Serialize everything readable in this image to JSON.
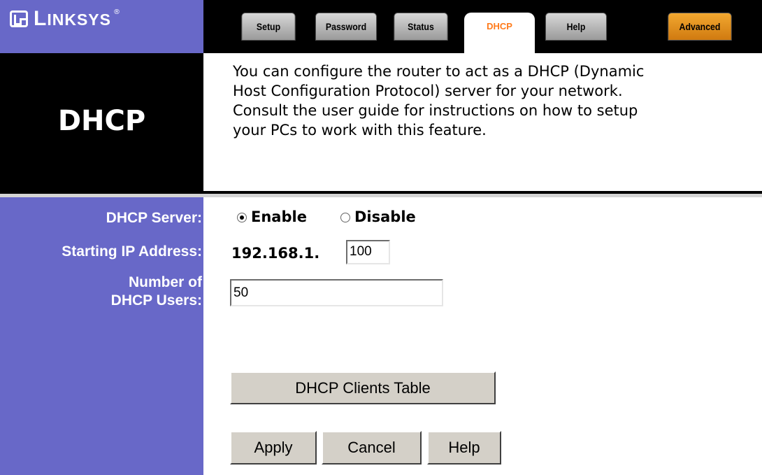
{
  "brand": {
    "name_big": "L",
    "name_rest": "INKSYS",
    "registered": "®"
  },
  "tabs": [
    {
      "label": "Setup"
    },
    {
      "label": "Password"
    },
    {
      "label": "Status"
    },
    {
      "label": "DHCP"
    },
    {
      "label": "Help"
    },
    {
      "label": "Advanced"
    }
  ],
  "active_tab": "DHCP",
  "page": {
    "title": "DHCP",
    "description": [
      "You can configure the router to act as a DHCP (Dynamic",
      "Host Configuration Protocol) server for your network.",
      "Consult the user guide for instructions on how to setup",
      "your PCs to work with this feature."
    ]
  },
  "form": {
    "dhcp_server_label": "DHCP Server:",
    "enable_label": "Enable",
    "disable_label": "Disable",
    "dhcp_server_value": "Enable",
    "starting_ip_label": "Starting IP Address:",
    "ip_prefix": "192.168.1.",
    "ip_last_octet": "100",
    "num_users_label_line1": "Number of",
    "num_users_label_line2": "DHCP Users:",
    "num_users_value": "50"
  },
  "buttons": {
    "clients_table": "DHCP Clients Table",
    "apply": "Apply",
    "cancel": "Cancel",
    "help": "Help"
  },
  "colors": {
    "brand_purple": "#6868c8",
    "active_tab_text": "#ff7a1a",
    "advanced_tab": "#e8921e"
  }
}
